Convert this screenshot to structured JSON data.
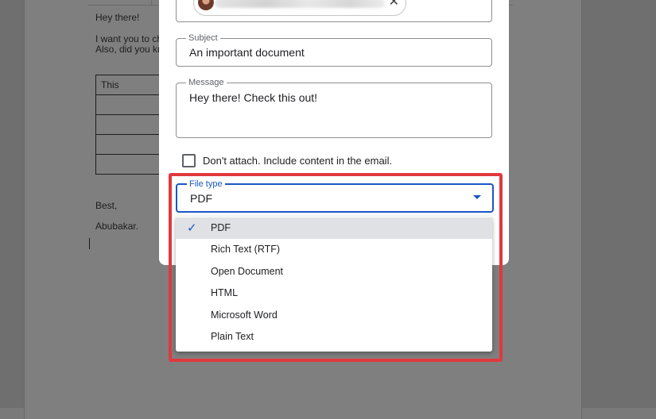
{
  "document": {
    "greeting": "Hey there!",
    "line1": "I want you to ch",
    "line2": "Also, did you kn",
    "table_header": "This",
    "closing": "Best,",
    "signature": "Abubakar."
  },
  "dialog": {
    "subject": {
      "label": "Subject",
      "value": "An important document"
    },
    "message": {
      "label": "Message",
      "value": "Hey there! Check this out!"
    },
    "dont_attach_label": "Don't attach. Include content in the email.",
    "file_type": {
      "label": "File type",
      "value": "PDF",
      "options": [
        {
          "label": "PDF",
          "selected": true
        },
        {
          "label": "Rich Text (RTF)",
          "selected": false
        },
        {
          "label": "Open Document",
          "selected": false
        },
        {
          "label": "HTML",
          "selected": false
        },
        {
          "label": "Microsoft Word",
          "selected": false
        },
        {
          "label": "Plain Text",
          "selected": false
        }
      ]
    }
  },
  "icons": {
    "chip_remove": "close-icon",
    "dropdown": "caret-down-icon",
    "selected_option": "check-icon"
  },
  "colors": {
    "accent": "#1a57c5",
    "highlight": "#e0393e",
    "selected_bg": "#dfe1e5"
  }
}
